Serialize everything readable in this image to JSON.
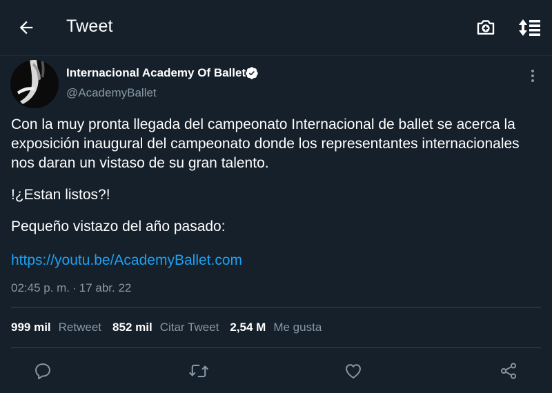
{
  "header": {
    "title": "Tweet"
  },
  "author": {
    "name": "Internacional Academy Of Ballet",
    "handle": "@AcademyBallet",
    "verified": true
  },
  "tweet": {
    "paragraphs": [
      "Con la muy pronta llegada del campeonato Internacional de ballet se acerca la exposición inaugural del campeonato donde los representantes internacionales nos daran un vistaso de su gran talento.",
      "!¿Estan listos?!",
      "Pequeño vistazo del año pasado:"
    ],
    "link": "https://youtu.be/AcademyBallet.com",
    "time": "02:45 p. m.",
    "separator": "·",
    "date": "17 abr. 22"
  },
  "stats": {
    "retweets_count": "999 mil",
    "retweets_label": "Retweet",
    "quotes_count": "852 mil",
    "quotes_label": "Citar Tweet",
    "likes_count": "2,54 M",
    "likes_label": "Me gusta"
  },
  "colors": {
    "background": "#15202b",
    "text_primary": "#ffffff",
    "text_secondary": "#8899a6",
    "accent": "#1da1f2",
    "divider": "#38444d"
  },
  "icons": {
    "back": "arrow-left-icon",
    "camera": "camera-add-icon",
    "sort": "sort-icon",
    "verified": "verified-badge-icon",
    "more": "more-vertical-icon",
    "reply": "reply-icon",
    "retweet": "retweet-icon",
    "like": "heart-icon",
    "share": "share-icon"
  }
}
